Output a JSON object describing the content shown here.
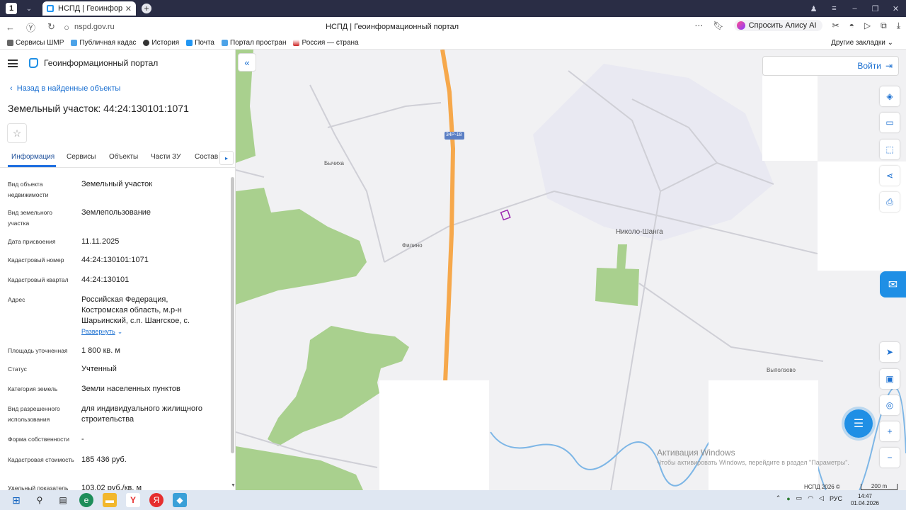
{
  "browser": {
    "tab_counter": "1",
    "tab_title": "НСПД | Геоинформаци",
    "url": "nspd.gov.ru",
    "page_title": "НСПД | Геоинформационный портал",
    "alice_label": "Спросить Алису AI",
    "bookmarks": [
      "Сервисы ШМР",
      "Публичная кадас",
      "История",
      "Почта",
      "Портал простран",
      "Россия — страна"
    ],
    "other_bookmarks": "Другие закладки"
  },
  "panel": {
    "app_title": "Геоинформационный портал",
    "back_link": "Назад в найденные объекты",
    "object_title": "Земельный участок: 44:24:130101:1071",
    "tabs": [
      "Информация",
      "Сервисы",
      "Объекты",
      "Части ЗУ",
      "Состав"
    ],
    "properties": [
      {
        "label": "Вид объекта недвижимости",
        "value": "Земельный участок"
      },
      {
        "label": "Вид земельного участка",
        "value": "Землепользование"
      },
      {
        "label": "Дата присвоения",
        "value": "11.11.2025"
      },
      {
        "label": "Кадастровый номер",
        "value": "44:24:130101:1071"
      },
      {
        "label": "Кадастровый квартал",
        "value": "44:24:130101"
      },
      {
        "label": "Адрес",
        "value": "Российская Федерация, Костромская область, м.р-н Шарьинский, с.п. Шангское, с.",
        "expand": "Развернуть"
      },
      {
        "label": "Площадь уточненная",
        "value": "1 800 кв. м"
      },
      {
        "label": "Статус",
        "value": "Учтенный"
      },
      {
        "label": "Категория земель",
        "value": "Земли населенных пунктов"
      },
      {
        "label": "Вид разрешенного использования",
        "value": "для индивидуального жилищного строительства"
      },
      {
        "label": "Форма собственности",
        "value": "-"
      },
      {
        "label": "Кадастровая стоимость",
        "value": "185 436 руб."
      },
      {
        "label": "Удельный показатель",
        "value": "103.02 руб./кв. м"
      }
    ]
  },
  "map": {
    "login_label": "Войти",
    "road_label": "34Р-18",
    "places": [
      "Бычиха",
      "Филино",
      "Николо-Шанга",
      "Выползово"
    ],
    "windows_activation_title": "Активация Windows",
    "windows_activation_text": "Чтобы активировать Windows, перейдите в раздел \"Параметры\".",
    "copyright": "НСПД 2026 ©",
    "scale_label": "200 m",
    "colors": {
      "forest": "#a9d08e",
      "road": "#f6a84b",
      "parcel": "#9c27b0",
      "accent": "#1f8fe5"
    }
  },
  "taskbar": {
    "lang": "РУС",
    "time": "14:47",
    "date": "01.04.2026"
  }
}
